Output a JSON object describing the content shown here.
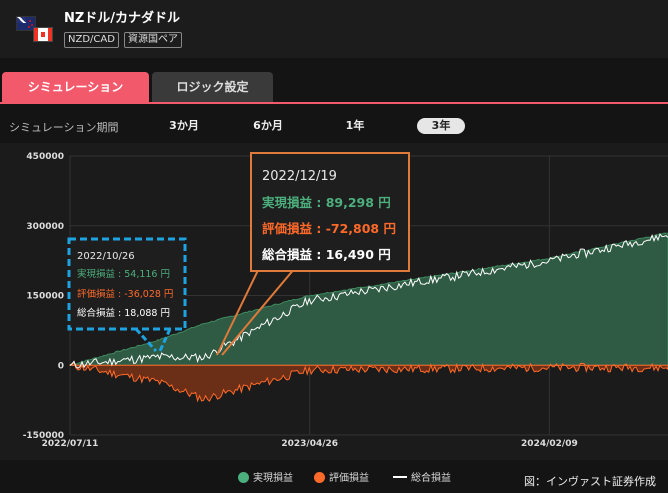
{
  "header": {
    "pair_name": "NZドル/カナダドル",
    "tag_code": "NZD/CAD",
    "tag_category": "資源国ペア",
    "icons": [
      "nz-flag-icon",
      "canada-flag-icon"
    ]
  },
  "tabs": [
    {
      "label": "シミュレーション",
      "active": true
    },
    {
      "label": "ロジック設定",
      "active": false
    }
  ],
  "period": {
    "label": "シミュレーション期間",
    "options": [
      "3か月",
      "6か月",
      "1年",
      "3年"
    ],
    "selected": "3年"
  },
  "colors": {
    "accent": "#f25a6c",
    "realized": "#4caf7d",
    "unrealized": "#ff6a2a",
    "total": "#ffffff",
    "callout_orange": "#e07a3a",
    "callout_blue": "#1fa3e0"
  },
  "chart_data": {
    "type": "area",
    "y_ticks": [
      "450000",
      "300000",
      "150000",
      "0",
      "-150000"
    ],
    "x_ticks": [
      "2022/07/11",
      "2023/04/26",
      "2024/02/09"
    ],
    "ylim": [
      -150000,
      450000
    ],
    "grid": true,
    "series": [
      {
        "name": "実現損益",
        "x": [
          "2022/07/11",
          "2022/10/26",
          "2022/12/19",
          "2023/04/26",
          "2024/02/09",
          "2024/07/01"
        ],
        "values": [
          0,
          54116,
          89298,
          150000,
          230000,
          285000
        ]
      },
      {
        "name": "評価損益",
        "x": [
          "2022/07/11",
          "2022/10/26",
          "2022/12/19",
          "2023/04/26",
          "2024/02/09",
          "2024/07/01"
        ],
        "values": [
          0,
          -36028,
          -72808,
          -10000,
          -5000,
          -5000
        ]
      },
      {
        "name": "総合損益",
        "x": [
          "2022/07/11",
          "2022/10/26",
          "2022/12/19",
          "2023/04/26",
          "2024/02/09",
          "2024/07/01"
        ],
        "values": [
          0,
          18088,
          16490,
          140000,
          225000,
          280000
        ]
      }
    ],
    "legend": [
      "実現損益",
      "評価損益",
      "総合損益"
    ],
    "legend_position": "bottom"
  },
  "callout_orange": {
    "date": "2022/12/19",
    "realized": "実現損益 : 89,298 円",
    "unrealized": "評価損益 : -72,808 円",
    "total": "総合損益 : 16,490 円"
  },
  "callout_blue": {
    "date": "2022/10/26",
    "realized": "実現損益 : 54,116 円",
    "unrealized": "評価損益 : -36,028 円",
    "total": "総合損益 : 18,088 円"
  },
  "credit": "図：インヴァスト証券作成"
}
